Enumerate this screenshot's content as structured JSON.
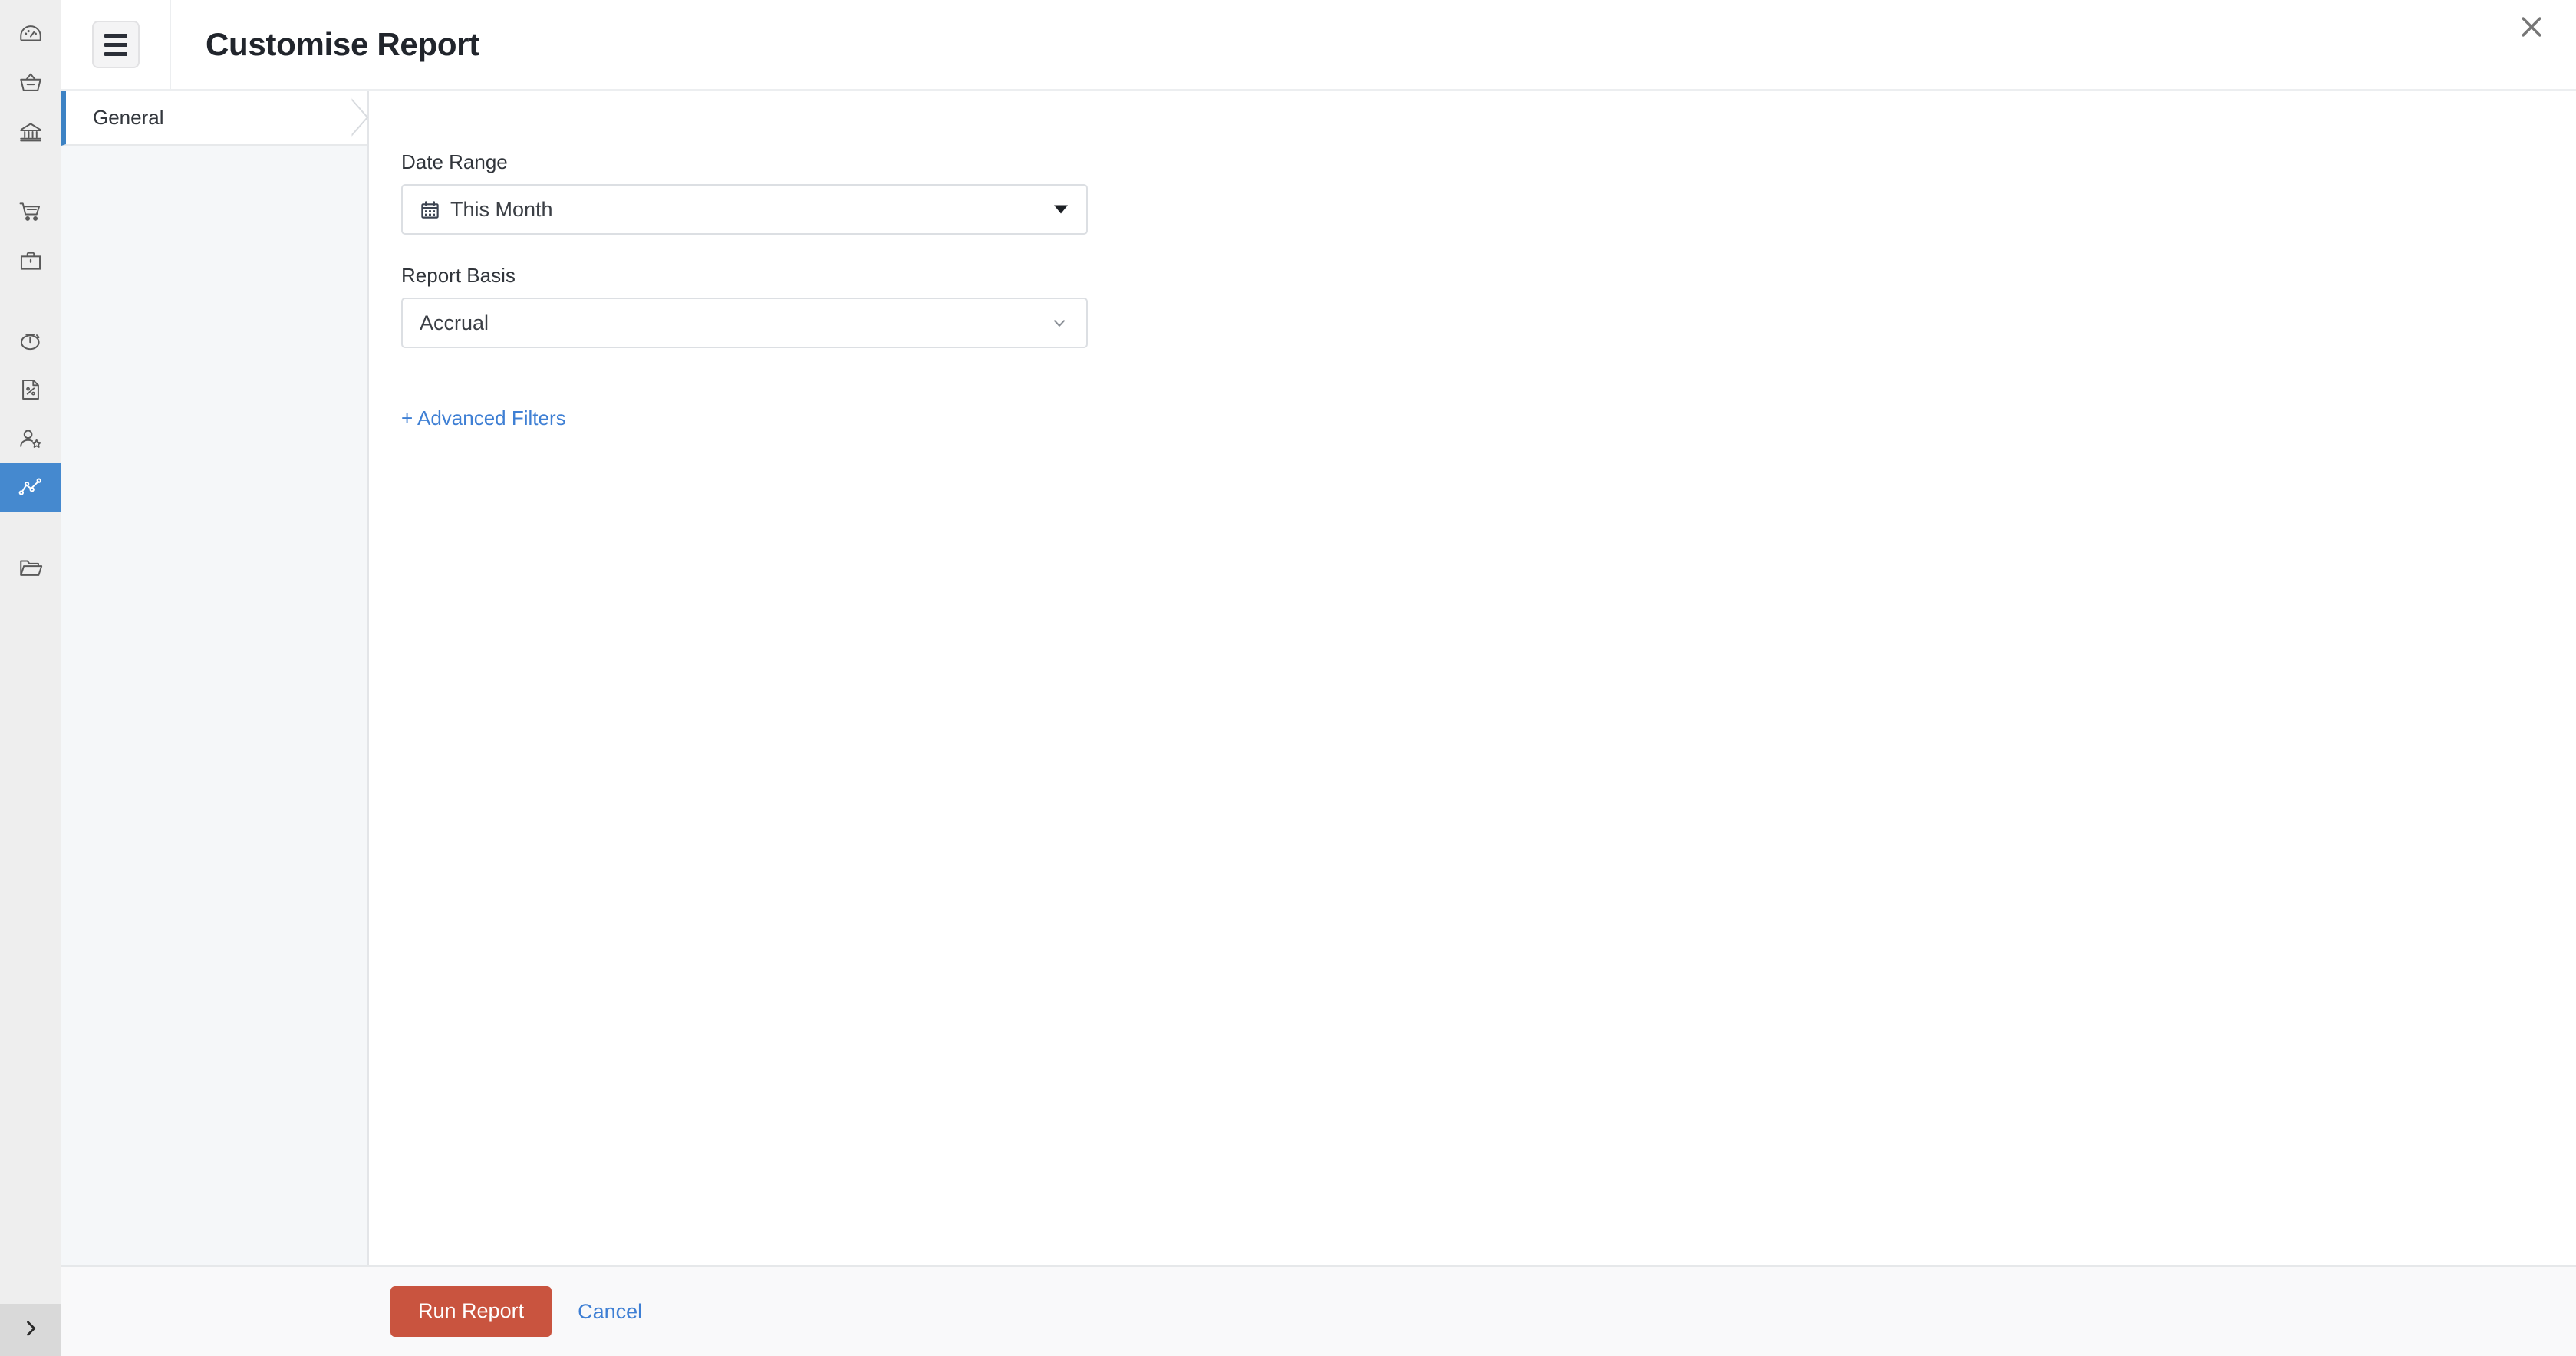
{
  "window": {
    "title": "Customise Report",
    "close_icon": "close-icon",
    "menu_icon": "hamburger-menu-icon"
  },
  "sidebar": {
    "expand_icon": "chevron-right-icon",
    "items": [
      {
        "icon": "dashboard-gauge-icon",
        "name": "dashboard",
        "active": false,
        "gap": false
      },
      {
        "icon": "basket-icon",
        "name": "sales",
        "active": false,
        "gap": false
      },
      {
        "icon": "bank-icon",
        "name": "banking",
        "active": false,
        "gap": false
      },
      {
        "icon": "shopping-cart-icon",
        "name": "purchases",
        "active": false,
        "gap": true
      },
      {
        "icon": "briefcase-icon",
        "name": "items",
        "active": false,
        "gap": false
      },
      {
        "icon": "stopwatch-icon",
        "name": "time-tracking",
        "active": false,
        "gap": true
      },
      {
        "icon": "document-percent-icon",
        "name": "taxes",
        "active": false,
        "gap": false
      },
      {
        "icon": "user-star-icon",
        "name": "accountant",
        "active": false,
        "gap": false
      },
      {
        "icon": "line-chart-icon",
        "name": "reports",
        "active": true,
        "gap": false
      },
      {
        "icon": "open-folder-icon",
        "name": "documents",
        "active": false,
        "gap": true
      }
    ]
  },
  "tabs": {
    "items": [
      {
        "label": "General",
        "active": true
      }
    ]
  },
  "form": {
    "date_range": {
      "label": "Date Range",
      "value": "This Month",
      "icon": "calendar-icon",
      "caret": "caret-down-solid-icon"
    },
    "report_basis": {
      "label": "Report Basis",
      "value": "Accrual",
      "caret": "chevron-down-icon"
    },
    "advanced_filters_label": "+ Advanced Filters"
  },
  "footer": {
    "run_report_label": "Run Report",
    "cancel_label": "Cancel"
  },
  "colors": {
    "accent_blue": "#3c82c4",
    "primary_button": "#c9543f",
    "link_blue": "#3e7fd4",
    "rail_background": "#eeeeee",
    "tabpanel_background": "#f5f7f9"
  }
}
